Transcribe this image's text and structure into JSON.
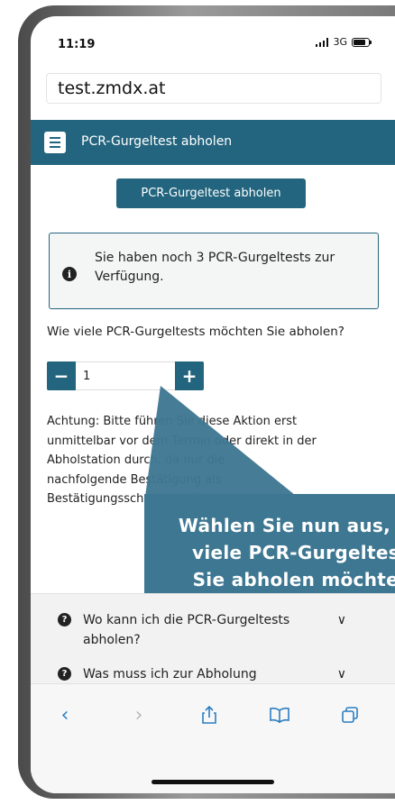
{
  "status_bar": {
    "time": "11:19",
    "network": "3G",
    "battery_level": 0.8
  },
  "browser": {
    "url": "test.zmdx.at"
  },
  "header": {
    "title": "PCR-Gurgeltest abholen",
    "menu_icon": "hamburger-menu-icon"
  },
  "page": {
    "action_button_label": "PCR-Gurgeltest abholen",
    "info_text": "Sie haben noch 3 PCR-Gurgeltests zur Verfügung.",
    "question": "Wie viele PCR-Gurgeltests möchten Sie abholen?",
    "quantity_value": "1",
    "minus_label": "−",
    "plus_label": "+",
    "warning_lines": [
      "Achtung: Bitte führen Sie diese Aktion erst",
      "unmittelbar vor dem Termin oder direkt in der",
      "Abholstation durch, da nur die",
      "nachfolgende Bestätigung als",
      "Bestätigungsschreiben gilt."
    ]
  },
  "callout": {
    "lines": [
      "Wählen Sie nun aus, wie",
      "viele PCR-Gurgeltests",
      "Sie abholen möchten."
    ]
  },
  "faq": [
    {
      "question": "Wo kann ich die PCR-Gurgeltests abholen?"
    },
    {
      "question": "Was muss ich zur Abholung"
    }
  ],
  "colors": {
    "primary": "#23657e",
    "callout": "#3e7792",
    "ios_blue": "#2b7ec1"
  },
  "toolbar_icons": [
    "back-icon",
    "forward-icon",
    "share-icon",
    "bookmarks-icon",
    "tabs-icon"
  ]
}
